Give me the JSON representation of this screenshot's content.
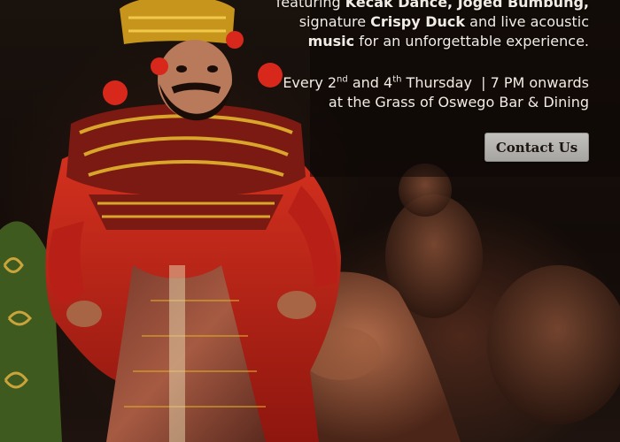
{
  "promo": {
    "line1_prefix": "featuring ",
    "line1_bold": "Kecak Dance, Joged Bumbung,",
    "line2_prefix": "signature ",
    "line2_bold": "Crispy Duck",
    "line2_suffix": " and live acoustic",
    "line3_bold": "music",
    "line3_suffix": " for an unforgettable experience."
  },
  "schedule": {
    "every": "Every 2",
    "sup1": "nd",
    "and": " and 4",
    "sup2": "th",
    "day_time": " Thursday  | 7 PM onwards",
    "venue": "at the Grass of Oswego Bar & Dining"
  },
  "cta": {
    "label": "Contact Us"
  },
  "colors": {
    "text": "#f2ece4",
    "button_bg": "#b5b3af",
    "costume_red": "#c8231c",
    "gold": "#d9a52a"
  }
}
